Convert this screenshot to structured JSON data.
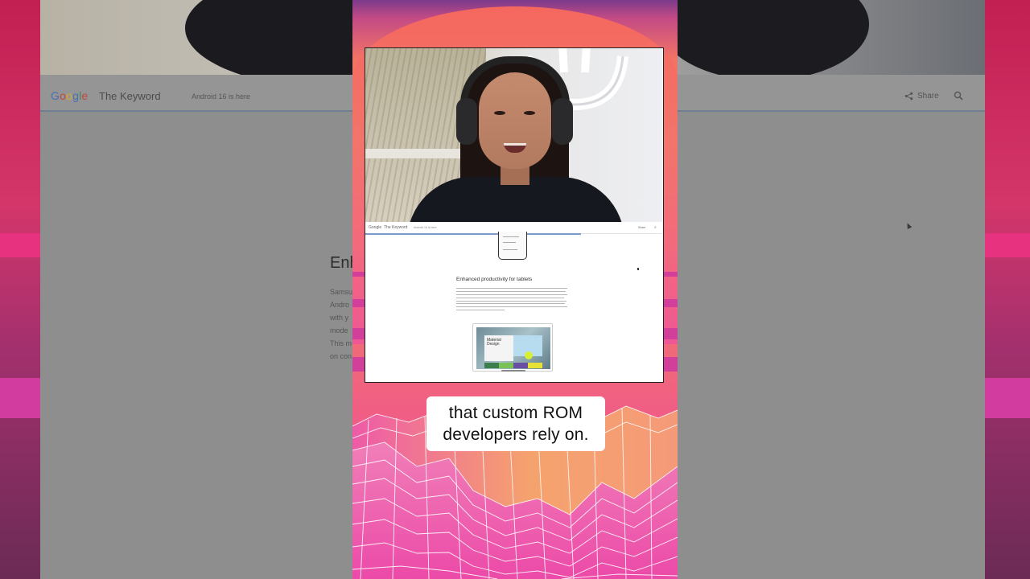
{
  "background_page": {
    "logo_text": "Google",
    "site_name": "The Keyword",
    "breadcrumb": "Android 16 is here",
    "share_label": "Share",
    "article_title_partial": "Enh",
    "article_lines_partial": [
      "Samsu",
      "Andro",
      "with y",
      "mode",
      "This m",
      "on con"
    ]
  },
  "recording": {
    "logo_text": "Google",
    "site_name": "The Keyword",
    "breadcrumb": "Android 16 is here",
    "share_label": "Share",
    "section_title": "Enhanced productivity for tablets",
    "tablet_card_title": "Material Design"
  },
  "caption": {
    "line1": "that custom ROM",
    "line2": "developers rely on."
  },
  "colors": {
    "short_sky": "#f27266",
    "short_terrain": "#ee4fa6",
    "terrain_lines": "#ffffff",
    "caption_bg": "#ffffff",
    "link_progress": "#7a9cc6"
  },
  "icons": [
    "share-icon",
    "search-icon"
  ]
}
